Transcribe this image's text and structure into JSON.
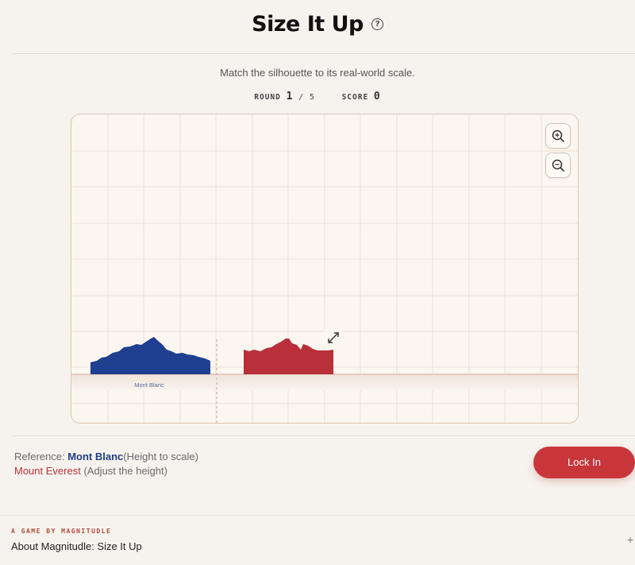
{
  "header": {
    "title": "Size It Up",
    "help_icon": "question-circle-icon"
  },
  "subtitle": "Match the silhouette to its real-world scale.",
  "stats": {
    "round_label": "ROUND",
    "round_current": "1",
    "round_sep": "/",
    "round_total": "5",
    "score_label": "SCORE",
    "score_value": "0"
  },
  "board": {
    "zoom_in_icon": "zoom-in-icon",
    "zoom_out_icon": "zoom-out-icon",
    "reference_label": "Mont Blanc",
    "resize_icon": "resize-diagonal-icon",
    "colors": {
      "reference": "#1f3f91",
      "target": "#b92f3a",
      "grid": "#ece2d7",
      "ground": "#d7a89e"
    }
  },
  "info": {
    "reference_prefix": "Reference:",
    "reference_name": "Mont Blanc",
    "reference_note": "(Height to scale)",
    "target_name": "Mount Everest",
    "target_note": "(Adjust the height)"
  },
  "lock_in_button": "Lock In",
  "footer": {
    "kicker": "A GAME BY MAGNITUDLE",
    "about": "About Magnitudle: Size It Up",
    "expand_icon": "plus-icon"
  }
}
